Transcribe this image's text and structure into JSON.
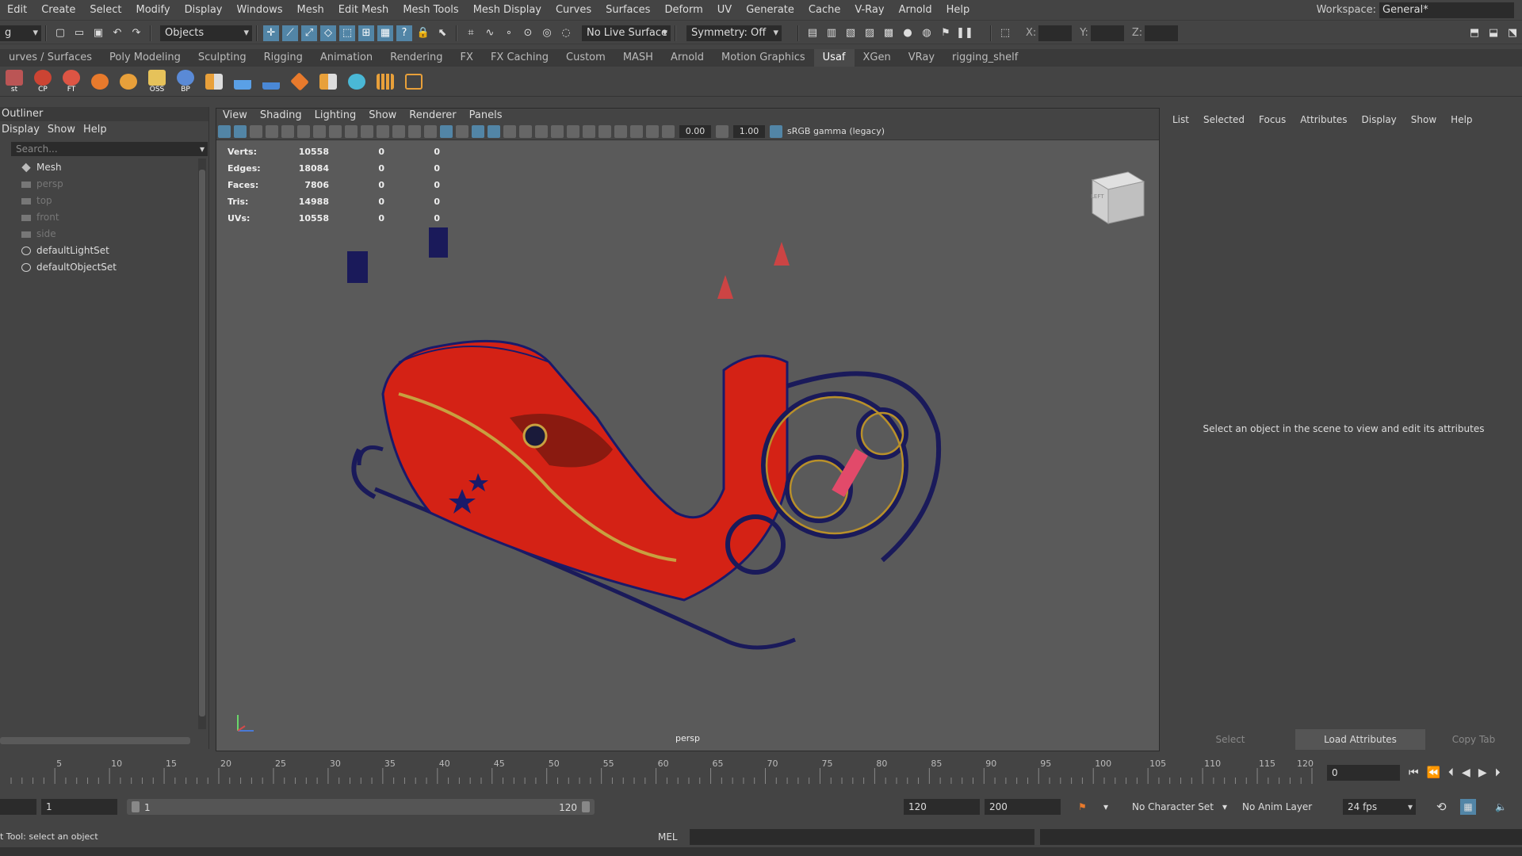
{
  "menu": {
    "items": [
      "Edit",
      "Create",
      "Select",
      "Modify",
      "Display",
      "Windows",
      "Mesh",
      "Edit Mesh",
      "Mesh Tools",
      "Mesh Display",
      "Curves",
      "Surfaces",
      "Deform",
      "UV",
      "Generate",
      "Cache",
      "V-Ray",
      "Arnold",
      "Help"
    ]
  },
  "workspace": {
    "label": "Workspace:",
    "value": "General*"
  },
  "status": {
    "mode_value": "g",
    "select_mode": "Objects",
    "live_surface": "No Live Surface",
    "symmetry": "Symmetry: Off",
    "x_label": "X:",
    "y_label": "Y:",
    "z_label": "Z:"
  },
  "shelf": {
    "tabs": [
      "urves / Surfaces",
      "Poly Modeling",
      "Sculpting",
      "Rigging",
      "Animation",
      "Rendering",
      "FX",
      "FX Caching",
      "Custom",
      "MASH",
      "Arnold",
      "Motion Graphics",
      "Usaf",
      "XGen",
      "VRay",
      "rigging_shelf"
    ],
    "active": "Usaf",
    "labels": [
      "st",
      "CP",
      "FT",
      "",
      "",
      "OSS",
      "BP"
    ]
  },
  "outliner": {
    "title": "Outliner",
    "menus": [
      "Display",
      "Show",
      "Help"
    ],
    "search_placeholder": "Search...",
    "items": [
      {
        "name": "Mesh",
        "type": "mesh",
        "dim": false
      },
      {
        "name": "persp",
        "type": "camera",
        "dim": true
      },
      {
        "name": "top",
        "type": "camera",
        "dim": true
      },
      {
        "name": "front",
        "type": "camera",
        "dim": true
      },
      {
        "name": "side",
        "type": "camera",
        "dim": true
      },
      {
        "name": "defaultLightSet",
        "type": "set",
        "dim": false
      },
      {
        "name": "defaultObjectSet",
        "type": "set",
        "dim": false
      }
    ]
  },
  "viewport": {
    "menus": [
      "View",
      "Shading",
      "Lighting",
      "Show",
      "Renderer",
      "Panels"
    ],
    "exposure": "0.00",
    "gamma": "1.00",
    "colorspace": "sRGB gamma (legacy)",
    "camera": "persp",
    "cube_label": "LEFT",
    "hud": [
      {
        "label": "Verts:",
        "v": "10558",
        "a": "0",
        "b": "0"
      },
      {
        "label": "Edges:",
        "v": "18084",
        "a": "0",
        "b": "0"
      },
      {
        "label": "Faces:",
        "v": "7806",
        "a": "0",
        "b": "0"
      },
      {
        "label": "Tris:",
        "v": "14988",
        "a": "0",
        "b": "0"
      },
      {
        "label": "UVs:",
        "v": "10558",
        "a": "0",
        "b": "0"
      }
    ]
  },
  "attr": {
    "menus": [
      "List",
      "Selected",
      "Focus",
      "Attributes",
      "Display",
      "Show",
      "Help"
    ],
    "message": "Select an object in the scene to view and edit its attributes",
    "select": "Select",
    "load": "Load Attributes",
    "copy": "Copy Tab"
  },
  "timeline": {
    "ticks": [
      "5",
      "10",
      "15",
      "20",
      "25",
      "30",
      "35",
      "40",
      "45",
      "50",
      "55",
      "60",
      "65",
      "70",
      "75",
      "80",
      "85",
      "90",
      "95",
      "100",
      "105",
      "110",
      "115",
      "120"
    ],
    "current": "0"
  },
  "range": {
    "start": "1",
    "slider_start": "1",
    "slider_end": "120",
    "end": "120",
    "max": "200",
    "char_set": "No Character Set",
    "anim_layer": "No Anim Layer",
    "fps": "24 fps"
  },
  "cmd": {
    "status": "t Tool: select an object",
    "lang": "MEL"
  }
}
